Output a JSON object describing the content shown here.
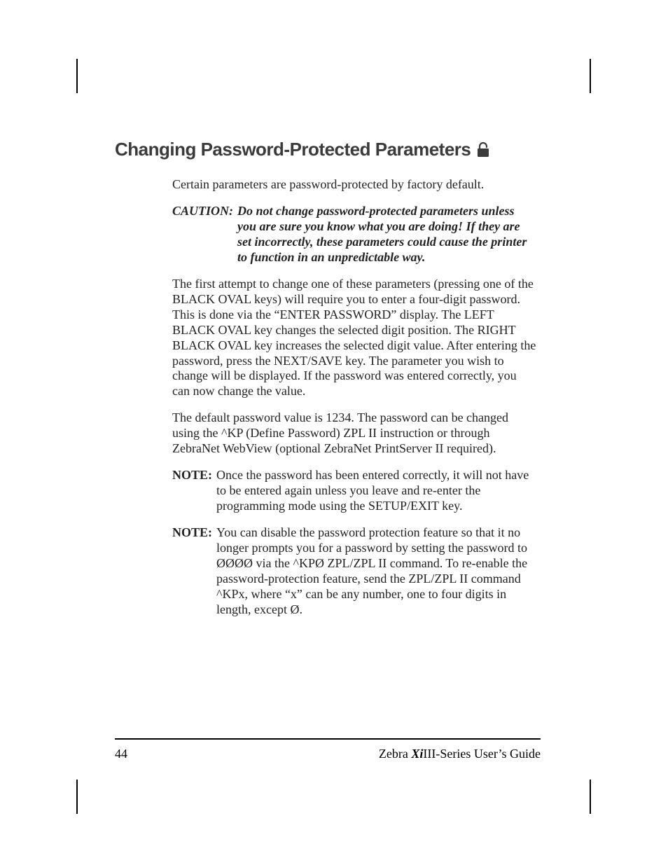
{
  "heading": "Changing Password-Protected Parameters",
  "icon_name": "lock-icon",
  "intro": "Certain parameters are password-protected by factory default.",
  "caution": {
    "label": "CAUTION:",
    "text": "Do not change password-protected parameters unless you are sure you know what you are doing!  If they are set incorrectly, these parameters could cause the printer to function in an unpredictable way."
  },
  "para1": "The first attempt to change one of these parameters (pressing one of the BLACK OVAL keys) will require you to enter a four-digit password.  This is done via the “ENTER PASSWORD” display.  The LEFT BLACK OVAL key changes the selected digit position.  The RIGHT BLACK OVAL key increases the selected digit value.  After entering the password, press the NEXT/SAVE key.  The parameter you wish to change will be displayed.  If the password was entered correctly, you can now change the value.",
  "para2": "The default password value is 1234.  The password can be changed using the ^KP (Define Password) ZPL II instruction or through ZebraNet WebView (optional ZebraNet PrintServer II required).",
  "notes": [
    {
      "label": "NOTE:",
      "text": "Once the password has been entered correctly, it will not have to be entered again unless you leave and re-enter the programming mode using the SETUP/EXIT key."
    },
    {
      "label": "NOTE:",
      "text": "You can disable the password protection feature so that it no longer prompts you for a password by setting the password to ØØØØ via the ^KPØ ZPL/ZPL II  command.  To re-enable the password-protection feature, send the ZPL/ZPL II command ^KPx, where “x” can be any number, one to four digits in length, except Ø."
    }
  ],
  "footer": {
    "page_number": "44",
    "brand_prefix": "Zebra ",
    "brand_model_italic": "Xi",
    "brand_suffix": "III-Series User’s Guide"
  }
}
